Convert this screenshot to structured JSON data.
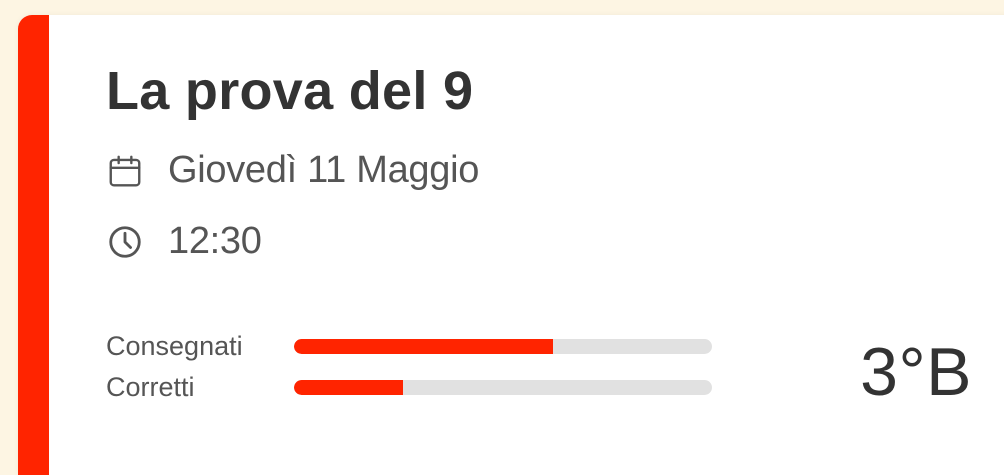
{
  "card": {
    "title": "La prova del 9",
    "date": "Giovedì 11 Maggio",
    "time": "12:30",
    "class_label": "3°B",
    "accent_color": "#ff2400",
    "icons": {
      "date": "calendar-icon",
      "time": "clock-icon"
    },
    "progress": [
      {
        "label": "Consegnati",
        "value": 0.62
      },
      {
        "label": "Corretti",
        "value": 0.26
      }
    ]
  }
}
